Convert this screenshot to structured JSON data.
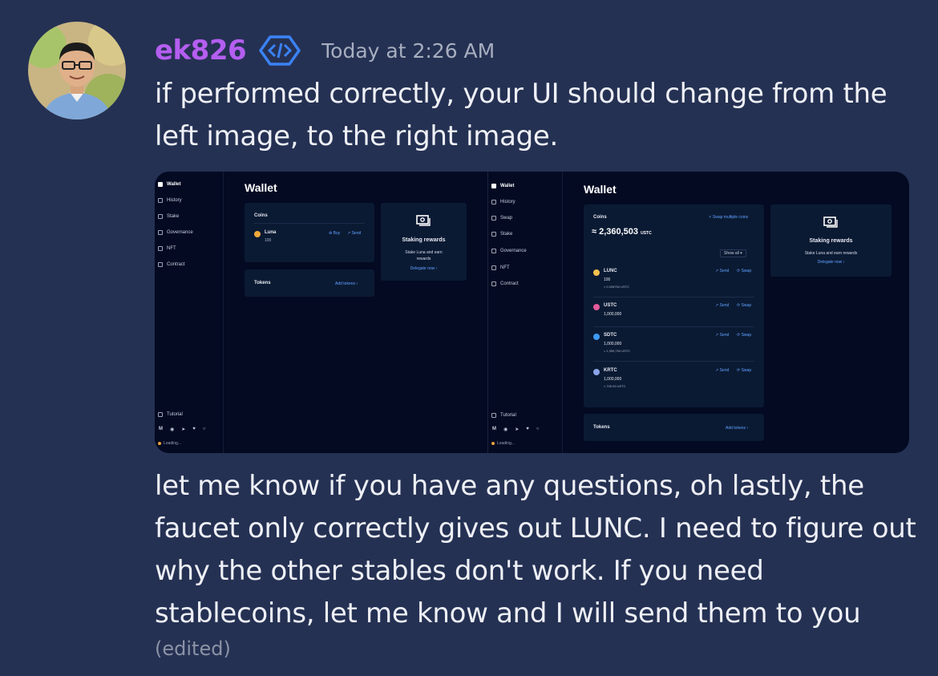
{
  "message": {
    "username": "ek826",
    "timestamp": "Today at 2:26 AM",
    "text_top": "if performed correctly, your UI should change from the left image, to the right image.",
    "text_bottom": "let me know if you have any questions, oh lastly, the faucet only correctly gives out LUNC.  I need to figure out why the other stables don't work.  If you need stablecoins, let me know and I will send them to you",
    "edited": "(edited)",
    "colors": {
      "username": "#b45ef0",
      "badge": "#3b82f6",
      "background": "#253153"
    }
  },
  "embed": {
    "left": {
      "nav": [
        "Wallet",
        "History",
        "Stake",
        "Governance",
        "NFT",
        "Contract"
      ],
      "tutorial": "Tutorial",
      "social": [
        "M",
        "discord",
        "telegram",
        "twitter",
        "github"
      ],
      "loading": "Loading...",
      "title": "Wallet",
      "coins_label": "Coins",
      "coin": {
        "name": "Luna",
        "amount": "100",
        "buy": "Buy",
        "send": "Send"
      },
      "tokens_label": "Tokens",
      "add_tokens": "Add tokens",
      "staking": {
        "title": "Staking rewards",
        "desc_1": "Stake Luna and earn",
        "desc_2": "rewards",
        "link": "Delegate now"
      }
    },
    "right": {
      "nav": [
        "Wallet",
        "History",
        "Swap",
        "Stake",
        "Governance",
        "NFT",
        "Contract"
      ],
      "tutorial": "Tutorial",
      "loading": "Loading...",
      "title": "Wallet",
      "coins_label": "Coins",
      "swap_multiple": "Swap multiple coins",
      "total": "≈ 2,360,503",
      "total_unit": "USTC",
      "show_all": "Show all",
      "coins": [
        {
          "name": "LUNC",
          "amount": "100",
          "value": "≈ 0.008754 USTC",
          "color": "#f2c14e"
        },
        {
          "name": "USTC",
          "amount": "1,000,000",
          "value": "",
          "color": "#e35a9a"
        },
        {
          "name": "SDTC",
          "amount": "1,000,000",
          "value": "≈ 1,359,754 USTC",
          "color": "#3d9bf2"
        },
        {
          "name": "KRTC",
          "amount": "1,000,000",
          "value": "≈ 745.09 USTC",
          "color": "#8aa5e8"
        }
      ],
      "send": "Send",
      "swap": "Swap",
      "tokens_label": "Tokens",
      "add_tokens": "Add tokens",
      "staking": {
        "title": "Staking rewards",
        "desc": "Stake Luna and earn rewards",
        "link": "Delegate now"
      }
    }
  }
}
